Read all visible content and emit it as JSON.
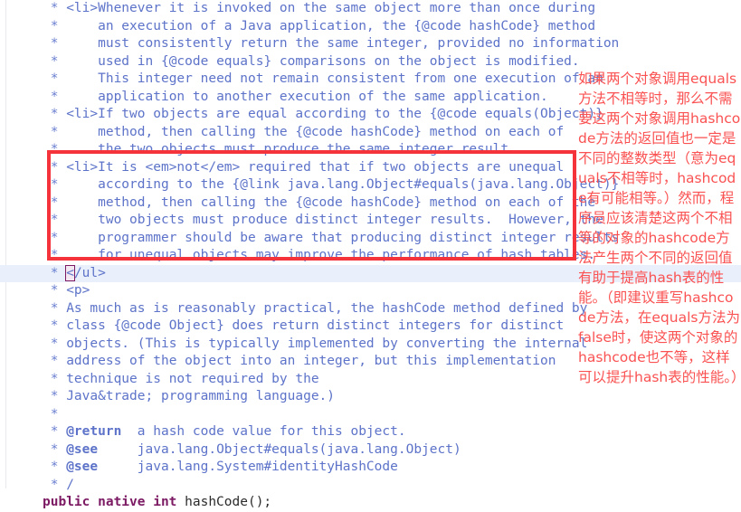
{
  "editor": {
    "language": "java",
    "caret_line_index": 17,
    "colors": {
      "background": "#ffffff",
      "comment_blue": "#5d73c9",
      "keyword_purple": "#7c1a63",
      "plain_text": "#2b2b2b",
      "caret_line_highlight": "#e9effb",
      "annotation_red": "#fa5252",
      "annotation_box_border": "#f5333a",
      "bracket_match_border": "#7c1a63"
    },
    "code_lines": [
      " * <li>Whenever it is invoked on the same object more than once during",
      " *     an execution of a Java application, the {@code hashCode} method",
      " *     must consistently return the same integer, provided no information",
      " *     used in {@code equals} comparisons on the object is modified.",
      " *     This integer need not remain consistent from one execution of an",
      " *     application to another execution of the same application.",
      " * <li>If two objects are equal according to the {@code equals(Object)}",
      " *     method, then calling the {@code hashCode} method on each of",
      " *     the two objects must produce the same integer result.",
      " * <li>It is <em>not</em> required that if two objects are unequal",
      " *     according to the {@link java.lang.Object#equals(java.lang.Object)}",
      " *     method, then calling the {@code hashCode} method on each of the",
      " *     two objects must produce distinct integer results.  However, the",
      " *     programmer should be aware that producing distinct integer results",
      " *     for unequal objects may improve the performance of hash tables.",
      " * </ul>",
      " * <p>",
      " * As much as is reasonably practical, the hashCode method defined by",
      " * class {@code Object} does return distinct integers for distinct",
      " * objects. (This is typically implemented by converting the internal",
      " * address of the object into an integer, but this implementation",
      " * technique is not required by the",
      " * Java&trade; programming language.)",
      " *",
      " * @return  a hash code value for this object.",
      " * @see     java.lang.Object#equals(java.lang.Object)",
      " * @see     java.lang.System#identityHashCode",
      " */",
      "public native int hashCode();"
    ],
    "signature": {
      "modifiers": "public native int",
      "method": " hashCode();"
    }
  },
  "annotation": {
    "box_label": "red-highlight-rectangle",
    "text": "如果两个对象调用equals方法不相等时，那么不需要这两个对象调用hashcode方法的返回值也一定是不同的整数类型（意为equals不相等时，hashcode有可能相等。）然而，程序员应该清楚这两个不相等的对象的hashcode方法产生两个不同的返回值有助于提高hash表的性能。（即建议重写hashcode方法，在equals方法为false时，使这两个对象的hashcode也不等，这样可以提升hash表的性能。）"
  }
}
